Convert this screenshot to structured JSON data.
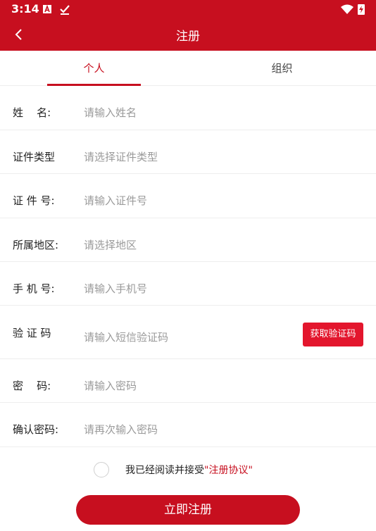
{
  "status_bar": {
    "time": "3:14"
  },
  "app_bar": {
    "title": "注册"
  },
  "tabs": [
    {
      "label": "个人",
      "active": true
    },
    {
      "label": "组织",
      "active": false
    }
  ],
  "form": {
    "name": {
      "label": "姓    名:",
      "placeholder": "请输入姓名"
    },
    "id_type": {
      "label": "证件类型",
      "placeholder": "请选择证件类型"
    },
    "id_number": {
      "label": "证 件 号:",
      "placeholder": "请输入证件号"
    },
    "region": {
      "label": "所属地区:",
      "placeholder": "请选择地区"
    },
    "phone": {
      "label": "手 机 号:",
      "placeholder": "请输入手机号"
    },
    "code": {
      "label": "验 证 码",
      "placeholder": "请输入短信验证码",
      "button": "获取验证码"
    },
    "password": {
      "label": "密    码:",
      "placeholder": "请输入密码"
    },
    "confirm_password": {
      "label": "确认密码:",
      "placeholder": "请再次输入密码"
    }
  },
  "agreement": {
    "text": "我已经阅读并接受",
    "link": "\"注册协议\""
  },
  "submit_label": "立即注册",
  "colors": {
    "primary": "#c70f1f",
    "button": "#e3162d",
    "placeholder": "#9a9a9a",
    "divider": "#eeeeee"
  }
}
